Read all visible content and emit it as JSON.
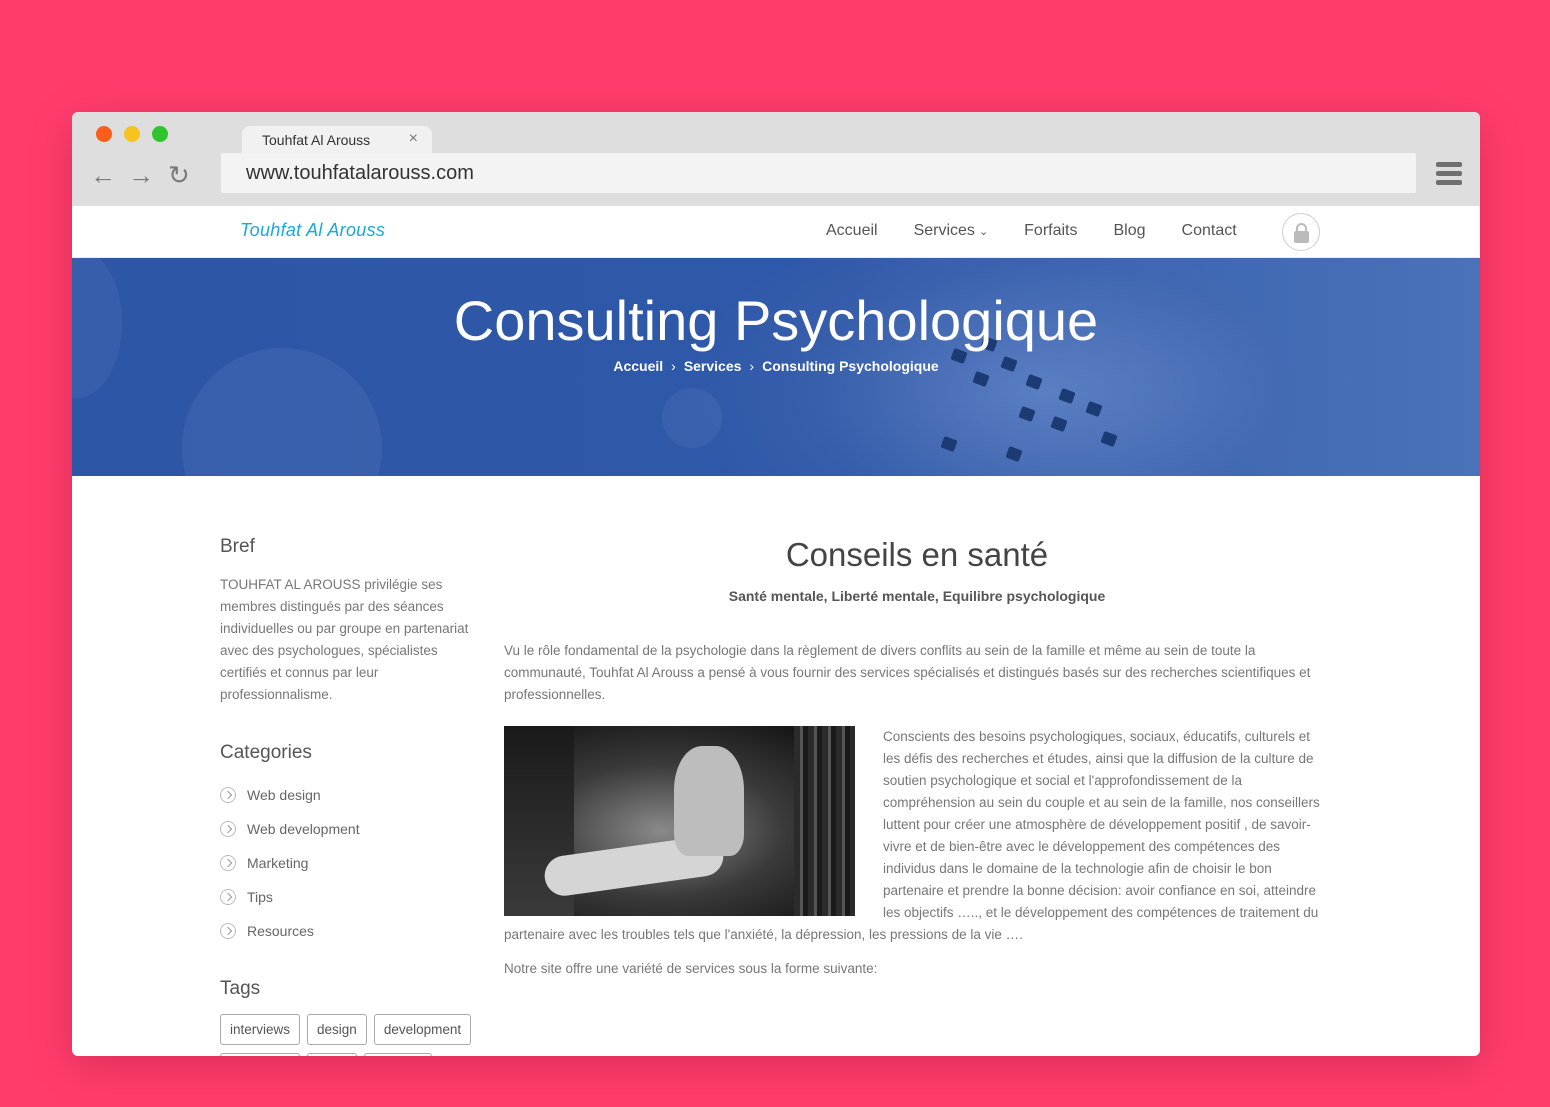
{
  "browser": {
    "tab_title": "Touhfat Al Arouss",
    "tab_close": "×",
    "url": "www.touhfatalarouss.com"
  },
  "header": {
    "logo": "Touhfat Al Arouss",
    "menu": [
      {
        "label": "Accueil"
      },
      {
        "label": "Services",
        "has_dropdown": true
      },
      {
        "label": "Forfaits"
      },
      {
        "label": "Blog"
      },
      {
        "label": "Contact"
      }
    ],
    "dropdown_glyph": "⌄",
    "lock_icon": "lock-icon"
  },
  "hero": {
    "title": "Consulting Psychologique",
    "breadcrumb": [
      "Accueil",
      "Services",
      "Consulting Psychologique"
    ],
    "separator": "›"
  },
  "sidebar": {
    "bref_title": "Bref",
    "bref_text": "TOUHFAT AL AROUSS privilégie ses membres distingués par des séances individuelles ou par groupe en partenariat avec des psychologues, spécialistes certifiés et connus par leur professionnalisme.",
    "categories_title": "Categories",
    "categories": [
      "Web design",
      "Web development",
      "Marketing",
      "Tips",
      "Resources"
    ],
    "tags_title": "Tags",
    "tags": [
      "interviews",
      "design",
      "development"
    ]
  },
  "main": {
    "title": "Conseils en santé",
    "subtitle": "Santé mentale, Liberté mentale, Equilibre psychologique",
    "paragraph1": "Vu le rôle fondamental de la psychologie dans la règlement de divers conflits au sein de la famille et même au sein de toute la communauté, Touhfat Al Arouss a pensé à vous fournir des services spécialisés et distingués basés sur des recherches scientifiques et professionnelles.",
    "paragraph2": "Conscients des besoins psychologiques, sociaux, éducatifs, culturels et les défis des recherches et études, ainsi que la diffusion de la culture de soutien psychologique et social et l'approfondissement de la compréhension au sein du couple et au sein de la famille, nos conseillers luttent pour créer une atmosphère de développement positif , de savoir-vivre et de bien-être avec le développement des compétences des individus dans le domaine de la technologie afin de choisir le bon partenaire et prendre la bonne décision: avoir confiance en soi, atteindre les objectifs ….., et le développement des compétences de traitement du partenaire avec les troubles tels que l'anxiété, la dépression, les pressions de la vie ….",
    "paragraph3": "Notre site offre une variété de services sous la forme suivante:"
  },
  "colors": {
    "background": "#ff3d6c",
    "hero": "#2e58a9",
    "logo": "#19a9d9"
  }
}
